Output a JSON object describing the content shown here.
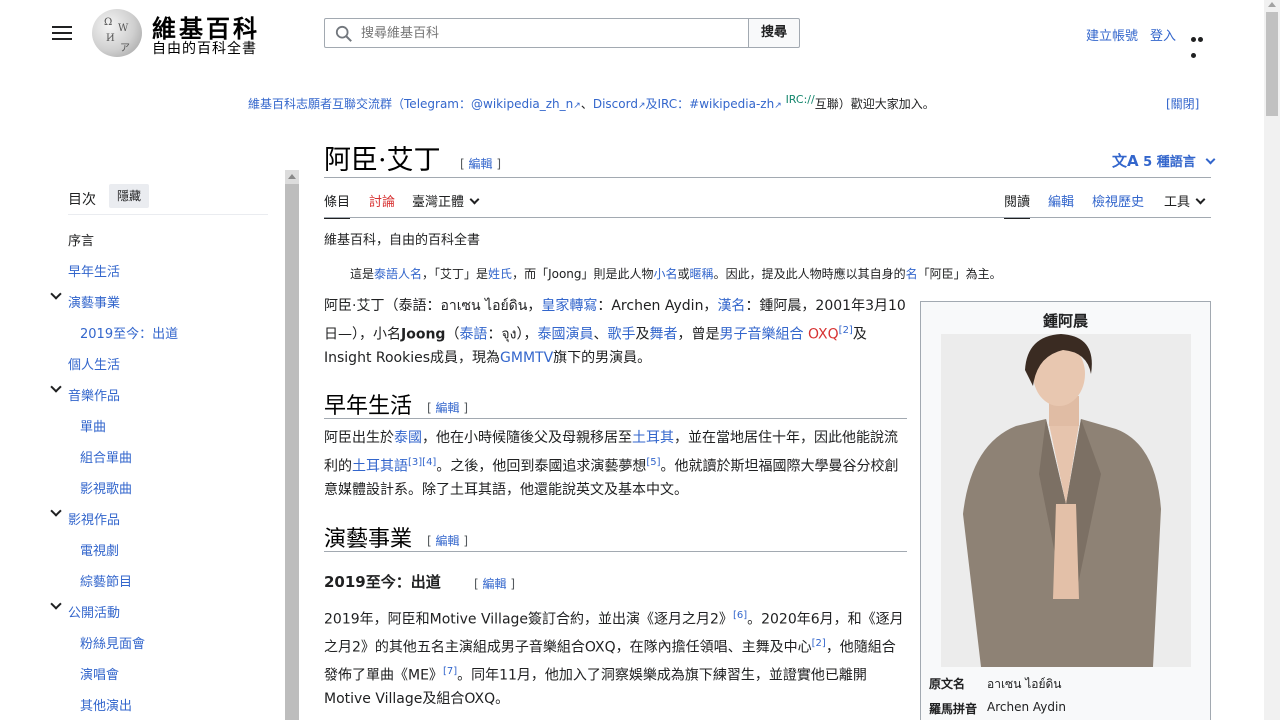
{
  "header": {
    "site_title": "維基百科",
    "site_tagline": "自由的百科全書",
    "search_placeholder": "搜尋維基百科",
    "search_button": "搜尋",
    "create_account": "建立帳號",
    "login": "登入"
  },
  "banner": {
    "part1": "維基百科志願者互聯交流群",
    "part2": "（Telegram：",
    "telegram": "@wikipedia_zh_n",
    "sep1": "、",
    "discord": "Discord",
    "part3": "及IRC：",
    "irc": "#wikipedia-zh",
    "irc_sup": "IRC://",
    "part4": "互聯）歡迎大家加入。",
    "close": "[關閉]"
  },
  "toc": {
    "header": "目次",
    "hide": "隱藏",
    "items": [
      {
        "label": "序言"
      },
      {
        "label": "早年生活"
      },
      {
        "label": "演藝事業"
      },
      {
        "label": "2019至今：出道"
      },
      {
        "label": "個人生活"
      },
      {
        "label": "音樂作品"
      },
      {
        "label": "單曲"
      },
      {
        "label": "組合單曲"
      },
      {
        "label": "影視歌曲"
      },
      {
        "label": "影視作品"
      },
      {
        "label": "電視劇"
      },
      {
        "label": "綜藝節目"
      },
      {
        "label": "公開活動"
      },
      {
        "label": "粉絲見面會"
      },
      {
        "label": "演唱會"
      },
      {
        "label": "其他演出"
      }
    ]
  },
  "article": {
    "title": "阿臣·艾丁",
    "edit": "[ 編輯 ]",
    "languages": "5 種語言",
    "tabs": {
      "article": "條目",
      "talk": "討論",
      "variant": "臺灣正體",
      "read": "閱讀",
      "edit": "編輯",
      "history": "檢視歷史",
      "tools": "工具"
    },
    "site_sub": "維基百科，自由的百科全書",
    "hatnote": {
      "a": "這是",
      "l1": "泰語人名",
      "b": "，「艾丁」是",
      "l2": "姓氏",
      "c": "，而「Joong」則是此人物",
      "l3": "小名",
      "d": "或",
      "l4": "暱稱",
      "e": "。因此，提及此人物時應以其自身的",
      "l5": "名",
      "f": "「阿臣」為主。"
    },
    "intro": {
      "t1": "阿臣·艾丁（泰語：อาเซน ไอย์ดิน，",
      "l1": "皇家轉寫",
      "t2": "：Archen Aydin，",
      "l2": "漢名",
      "t3": "：鍾阿晨，2001年3月10日—），小名",
      "joong": "Joong",
      "t4": "（",
      "l3": "泰語",
      "t5": "：จุง），",
      "l4": "泰國演員",
      "t6": "、",
      "l5": "歌手",
      "t7": "及",
      "l6": "舞者",
      "t8": "，曾是",
      "l7": "男子音樂組合",
      "red1": "OXQ",
      "ref1": "[2]",
      "t9": "及Insight Rookies成員，現為",
      "l8": "GMMTV",
      "t10": "旗下的男演員。"
    },
    "section1": {
      "heading": "早年生活",
      "edit": "[ 編輯 ]",
      "t1": "阿臣出生於",
      "l1": "泰國",
      "t2": "，他在小時候隨後父及母親移居至",
      "l2": "土耳其",
      "t3": "，並在當地居住十年，因此他能說流利的",
      "l3": "土耳其語",
      "ref1": "[3][4]",
      "t4": "。之後，他回到泰國追求演藝夢想",
      "ref2": "[5]",
      "t5": "。他就讀於斯坦福國際大學曼谷分校創意媒體設計系。除了土耳其語，他還能說英文及基本中文。"
    },
    "section2": {
      "heading": "演藝事業",
      "edit": "[ 編輯 ]",
      "sub_heading": "2019至今：出道",
      "sub_edit": "[ 編輯 ]",
      "t1": "2019年，阿臣和Motive Village簽訂合約，並出演《逐月之月2》",
      "ref1": "[6]",
      "t2": "。2020年6月，和《逐月之月2》的其他五名主演組成男子音樂組合OXQ，在隊內擔任領唱、主舞及中心",
      "ref2": "[2]",
      "t3": "，他隨組合發佈了單曲《ME》",
      "ref3": "[7]",
      "t4": "。同年11月，他加入了洞察娛樂成為旗下練習生，並證實他已離開Motive Village及組合OXQ。"
    },
    "infobox": {
      "title": "鍾阿晨",
      "rows": [
        {
          "label": "原文名",
          "value": "อาเซน ไอย์ดิน"
        },
        {
          "label": "羅馬拼音",
          "value": "Archen Aydin"
        }
      ]
    }
  },
  "colors": {
    "link": "#3366cc",
    "red_link": "#d73333",
    "border": "#a2a9b1"
  }
}
